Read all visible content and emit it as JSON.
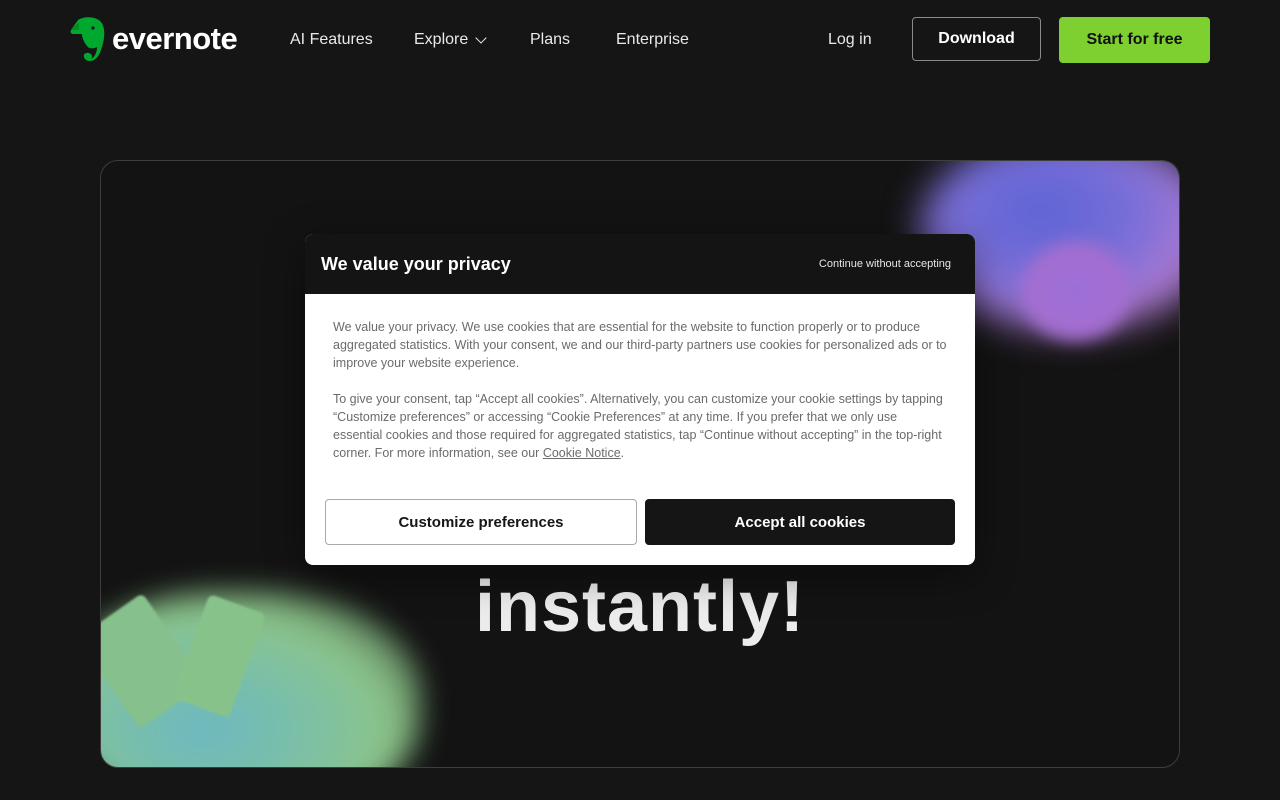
{
  "header": {
    "logo_text": "evernote",
    "nav": {
      "ai_features": "AI Features",
      "explore": "Explore",
      "plans": "Plans",
      "enterprise": "Enterprise"
    },
    "login": "Log in",
    "download": "Download",
    "start": "Start for free"
  },
  "hero": {
    "headline_fragment": "instantly!"
  },
  "cookie_modal": {
    "title": "We value your privacy",
    "continue_without": "Continue without accepting",
    "paragraph1": "We value your privacy. We use cookies that are essential for the website to function properly or to produce aggregated statistics. With your consent, we and our third-party partners use cookies for personalized ads or to improve your website experience.",
    "paragraph2": "To give your consent, tap “Accept all cookies”. Alternatively, you can customize your cookie settings by tapping “Customize preferences” or accessing “Cookie Preferences” at any time. If you prefer that we only use essential cookies and those required for aggregated statistics, tap “Continue without accepting” in the top-right corner. For more information, see our",
    "cookie_notice_link": "Cookie Notice",
    "period": ".",
    "customize": "Customize preferences",
    "accept": "Accept all cookies"
  },
  "colors": {
    "background": "#151515",
    "brand_green": "#7ed031",
    "logo_green": "#00a82d",
    "modal_dark": "#141414"
  },
  "icons": {
    "logo": "evernote-elephant-icon",
    "explore_dropdown": "chevron-down-icon"
  }
}
